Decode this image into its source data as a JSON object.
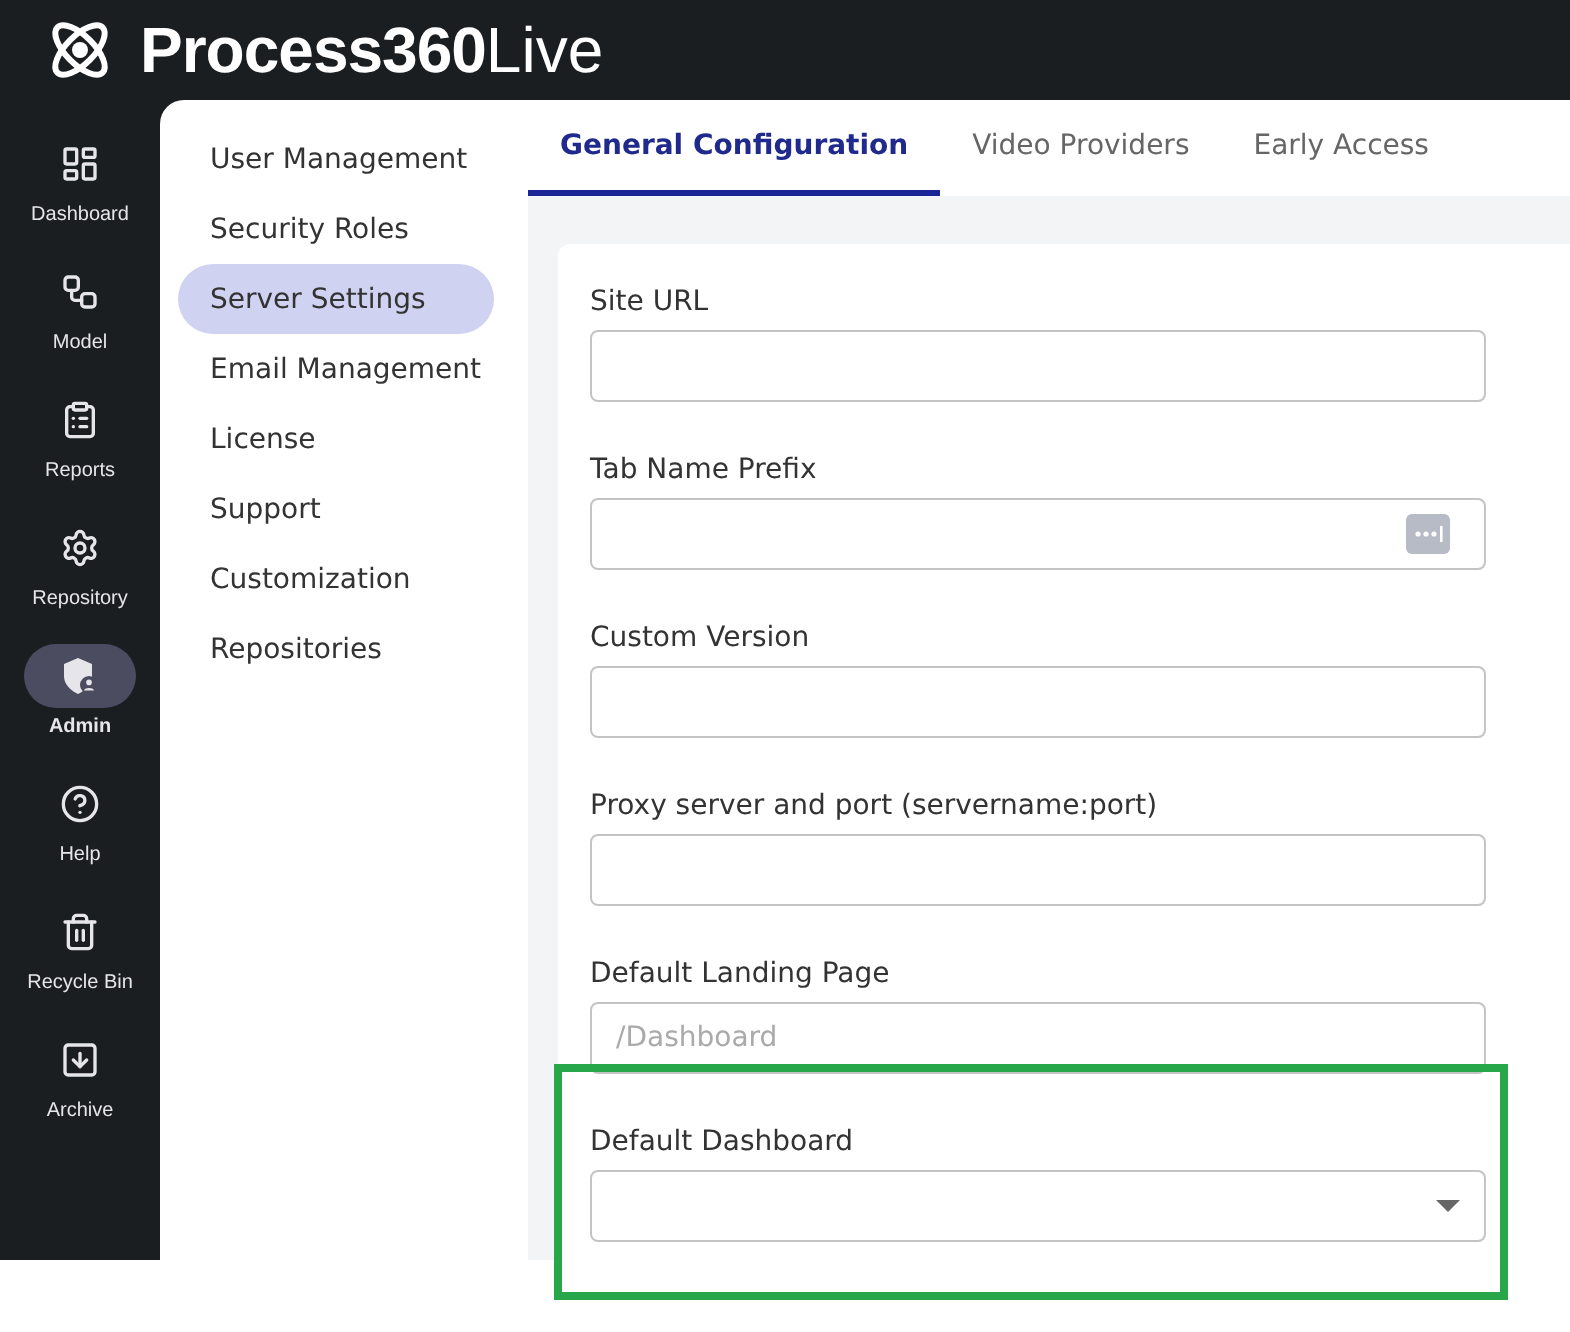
{
  "header": {
    "brand": "Process360",
    "brand_suffix": "Live"
  },
  "rail": [
    {
      "label": "Dashboard",
      "kind": "dashboard",
      "selected": false
    },
    {
      "label": "Model",
      "kind": "model",
      "selected": false
    },
    {
      "label": "Reports",
      "kind": "reports",
      "selected": false
    },
    {
      "label": "Repository",
      "kind": "repository",
      "selected": false
    },
    {
      "label": "Admin",
      "kind": "admin",
      "selected": true
    },
    {
      "label": "Help",
      "kind": "help",
      "selected": false
    },
    {
      "label": "Recycle Bin",
      "kind": "recycle",
      "selected": false
    },
    {
      "label": "Archive",
      "kind": "archive",
      "selected": false
    }
  ],
  "subnav": [
    {
      "label": "User Management",
      "selected": false
    },
    {
      "label": "Security Roles",
      "selected": false
    },
    {
      "label": "Server Settings",
      "selected": true
    },
    {
      "label": "Email Management",
      "selected": false
    },
    {
      "label": "License",
      "selected": false
    },
    {
      "label": "Support",
      "selected": false
    },
    {
      "label": "Customization",
      "selected": false
    },
    {
      "label": "Repositories",
      "selected": false
    }
  ],
  "tabs": [
    {
      "label": "General Configuration",
      "selected": true
    },
    {
      "label": "Video Providers",
      "selected": false
    },
    {
      "label": "Early Access",
      "selected": false
    }
  ],
  "fields": [
    {
      "label": "Site URL",
      "kind": "text",
      "highlighted": false
    },
    {
      "label": "Tab Name Prefix",
      "kind": "text-action",
      "highlighted": false
    },
    {
      "label": "Custom Version",
      "kind": "text",
      "highlighted": false
    },
    {
      "label": "Proxy server and port (servername:port)",
      "kind": "text",
      "highlighted": false
    },
    {
      "label": "Default Landing Page",
      "kind": "text",
      "placeholder": "/Dashboard",
      "highlighted": false
    },
    {
      "label": "Default Dashboard",
      "kind": "select",
      "highlighted": true
    }
  ]
}
